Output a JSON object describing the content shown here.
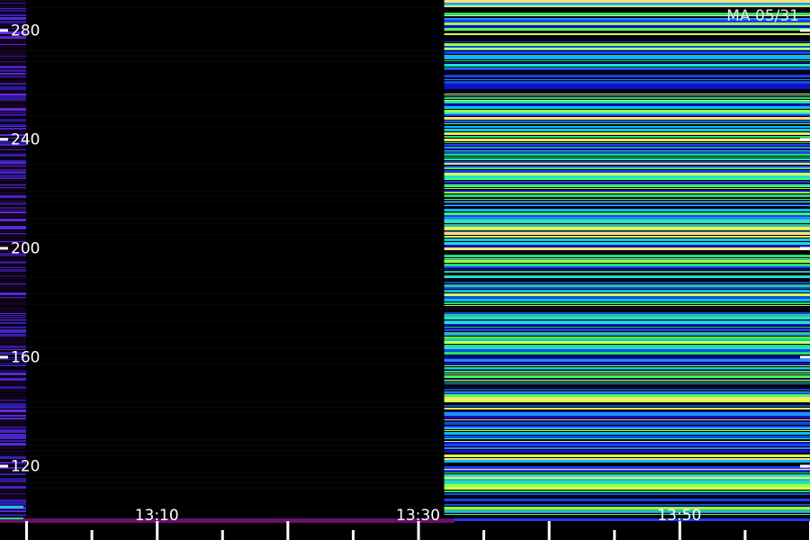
{
  "chart_data": {
    "type": "heatmap",
    "title": "",
    "xlabel": "",
    "ylabel": "",
    "stamp": "MA 05/31",
    "y_ticks": [
      120,
      160,
      200,
      240,
      280
    ],
    "ylim": [
      100,
      291
    ],
    "x_ticks": [
      "13:10",
      "13:30",
      "13:50"
    ],
    "x_range_minutes": [
      "12:58",
      "14:00"
    ],
    "segments": [
      {
        "start": "12:58",
        "end": "13:00",
        "description_level": "low",
        "palette": "violet-blue"
      },
      {
        "start": "13:00",
        "end": "13:32",
        "description_level": "none",
        "palette": "black"
      },
      {
        "start": "13:32",
        "end": "14:00",
        "description_level": "high",
        "palette": "blue-cyan-green-yellow"
      }
    ],
    "colors": {
      "background": "#000000",
      "axis": "#ffffff",
      "low_band": "#5a1e9a",
      "baseline": "#6a0f6a"
    }
  }
}
